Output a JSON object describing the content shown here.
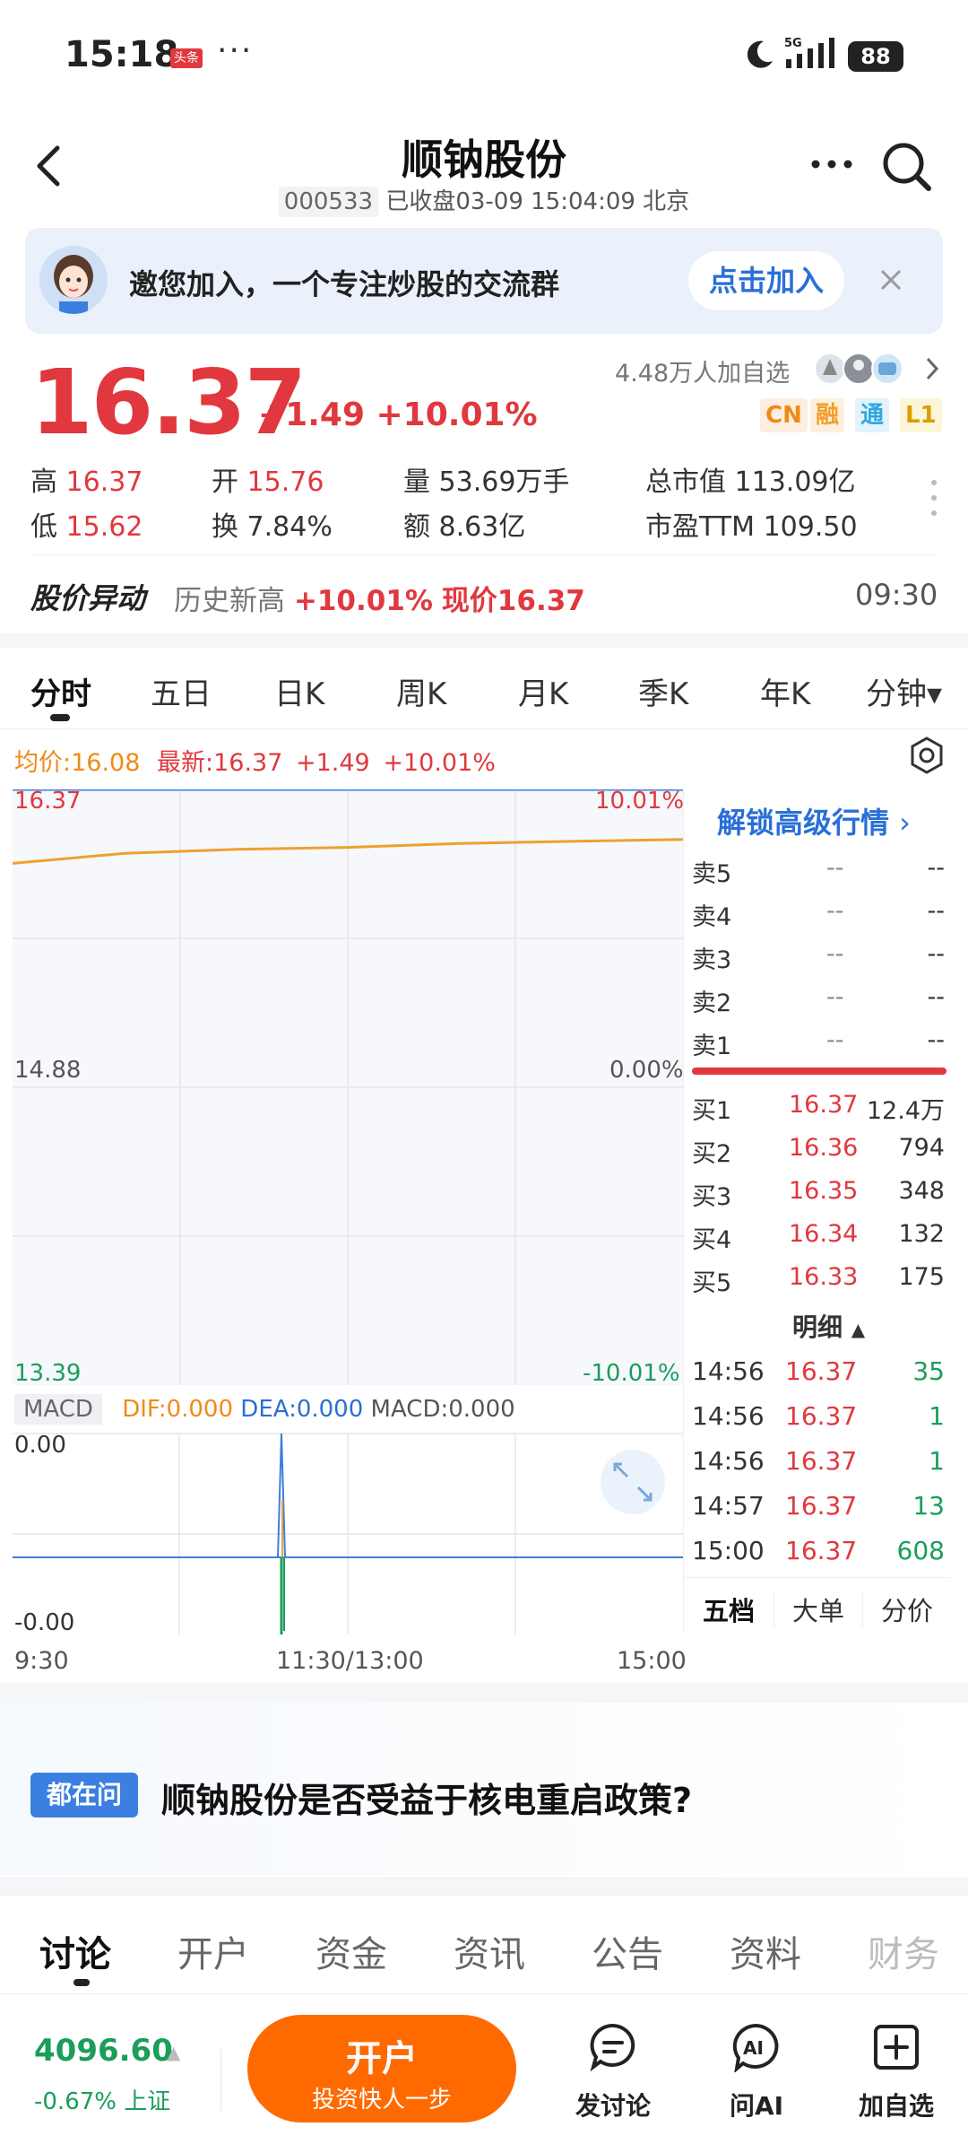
{
  "status_bar": {
    "time": "15:18",
    "app_badge": "头条",
    "dots": "···",
    "battery": "88"
  },
  "header": {
    "title": "顺钠股份",
    "code": "000533",
    "status": "已收盘03-09 15:04:09 北京"
  },
  "banner": {
    "text": "邀您加入，一个专注炒股的交流群",
    "join_label": "点击加入"
  },
  "quote": {
    "price": "16.37",
    "change": "+1.49 +10.01%",
    "watch_count": "4.48万人加自选",
    "tags": [
      "CN",
      "融",
      "通",
      "L1"
    ]
  },
  "stats": {
    "high_label": "高",
    "high": "16.37",
    "open_label": "开",
    "open": "15.76",
    "volume_label": "量",
    "volume": "53.69万手",
    "mktcap_label": "总市值",
    "mktcap": "113.09亿",
    "low_label": "低",
    "low": "15.62",
    "turnover_label": "换",
    "turnover": "7.84%",
    "amount_label": "额",
    "amount": "8.63亿",
    "pe_label": "市盈TTM",
    "pe": "109.50"
  },
  "abnormal": {
    "title": "股价异动",
    "text": "历史新高",
    "pct": "+10.01%",
    "current": "现价16.37",
    "time": "09:30"
  },
  "chart_tabs": [
    "分时",
    "五日",
    "日K",
    "周K",
    "月K",
    "季K",
    "年K",
    "分钟▾"
  ],
  "chart_info": {
    "avg": "均价:16.08",
    "latest": "最新:16.37",
    "chg": "+1.49",
    "pct": "+10.01%"
  },
  "chart_data": {
    "type": "line",
    "title": "",
    "x": [
      "9:30",
      "11:30/13:00",
      "15:00"
    ],
    "ylim": [
      13.39,
      16.37
    ],
    "y_left_ticks": [
      "16.37",
      "14.88",
      "13.39"
    ],
    "y_right_ticks": [
      "10.01%",
      "0.00%",
      "-10.01%"
    ],
    "series": [
      {
        "name": "均价",
        "color": "#f0a030",
        "values": [
          16.0,
          16.05,
          16.07,
          16.08,
          16.1,
          16.11,
          16.12
        ]
      },
      {
        "name": "最新",
        "color": "#3b7fe0",
        "values": [
          16.37,
          16.37,
          16.37,
          16.37,
          16.37,
          16.37,
          16.37
        ]
      }
    ],
    "grid": true
  },
  "macd": {
    "label": "MACD",
    "dif": "DIF:0.000",
    "dea": "DEA:0.000",
    "macd": "MACD:0.000",
    "y_top": "0.00",
    "y_bottom": "-0.00"
  },
  "time_axis": [
    "9:30",
    "11:30/13:00",
    "15:00"
  ],
  "orderbook": {
    "unlock": "解锁高级行情",
    "asks": [
      {
        "label": "卖5",
        "price": "--",
        "vol": "--"
      },
      {
        "label": "卖4",
        "price": "--",
        "vol": "--"
      },
      {
        "label": "卖3",
        "price": "--",
        "vol": "--"
      },
      {
        "label": "卖2",
        "price": "--",
        "vol": "--"
      },
      {
        "label": "卖1",
        "price": "--",
        "vol": "--"
      }
    ],
    "bids": [
      {
        "label": "买1",
        "price": "16.37",
        "vol": "12.4万"
      },
      {
        "label": "买2",
        "price": "16.36",
        "vol": "794"
      },
      {
        "label": "买3",
        "price": "16.35",
        "vol": "348"
      },
      {
        "label": "买4",
        "price": "16.34",
        "vol": "132"
      },
      {
        "label": "买5",
        "price": "16.33",
        "vol": "175"
      }
    ],
    "detail_title": "明细",
    "details": [
      {
        "time": "14:56",
        "price": "16.37",
        "vol": "35"
      },
      {
        "time": "14:56",
        "price": "16.37",
        "vol": "1"
      },
      {
        "time": "14:56",
        "price": "16.37",
        "vol": "1"
      },
      {
        "time": "14:57",
        "price": "16.37",
        "vol": "13"
      },
      {
        "time": "15:00",
        "price": "16.37",
        "vol": "608"
      }
    ],
    "tabs": [
      "五档",
      "大单",
      "分价"
    ]
  },
  "question": {
    "badge": "都在问",
    "text": "顺钠股份是否受益于核电重启政策?"
  },
  "bottom_tabs": [
    "讨论",
    "开户",
    "资金",
    "资讯",
    "公告",
    "资料",
    "财务"
  ],
  "bottom_bar": {
    "index_value": "4096.60",
    "index_change": "-0.67% 上证",
    "open_main": "开户",
    "open_sub": "投资快人一步",
    "discuss": "发讨论",
    "ask_ai": "问AI",
    "add_watch": "加自选"
  }
}
